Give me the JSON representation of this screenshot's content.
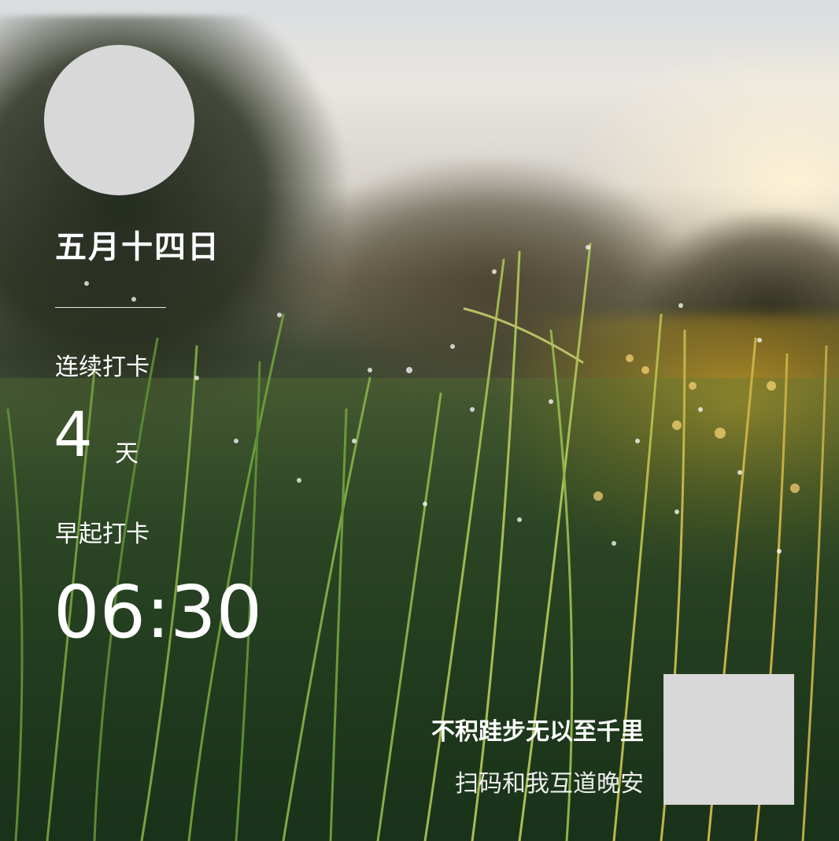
{
  "poster": {
    "date": "五月十四日",
    "streak_label": "连续打卡",
    "streak_days": "4",
    "streak_unit": "天",
    "early_label": "早起打卡",
    "early_time": "06:30",
    "motto": "不积跬步无以至千里",
    "scan_prompt": "扫码和我互道晚安"
  },
  "colors": {
    "placeholder": "#d8d8d8",
    "text": "#ffffff"
  }
}
